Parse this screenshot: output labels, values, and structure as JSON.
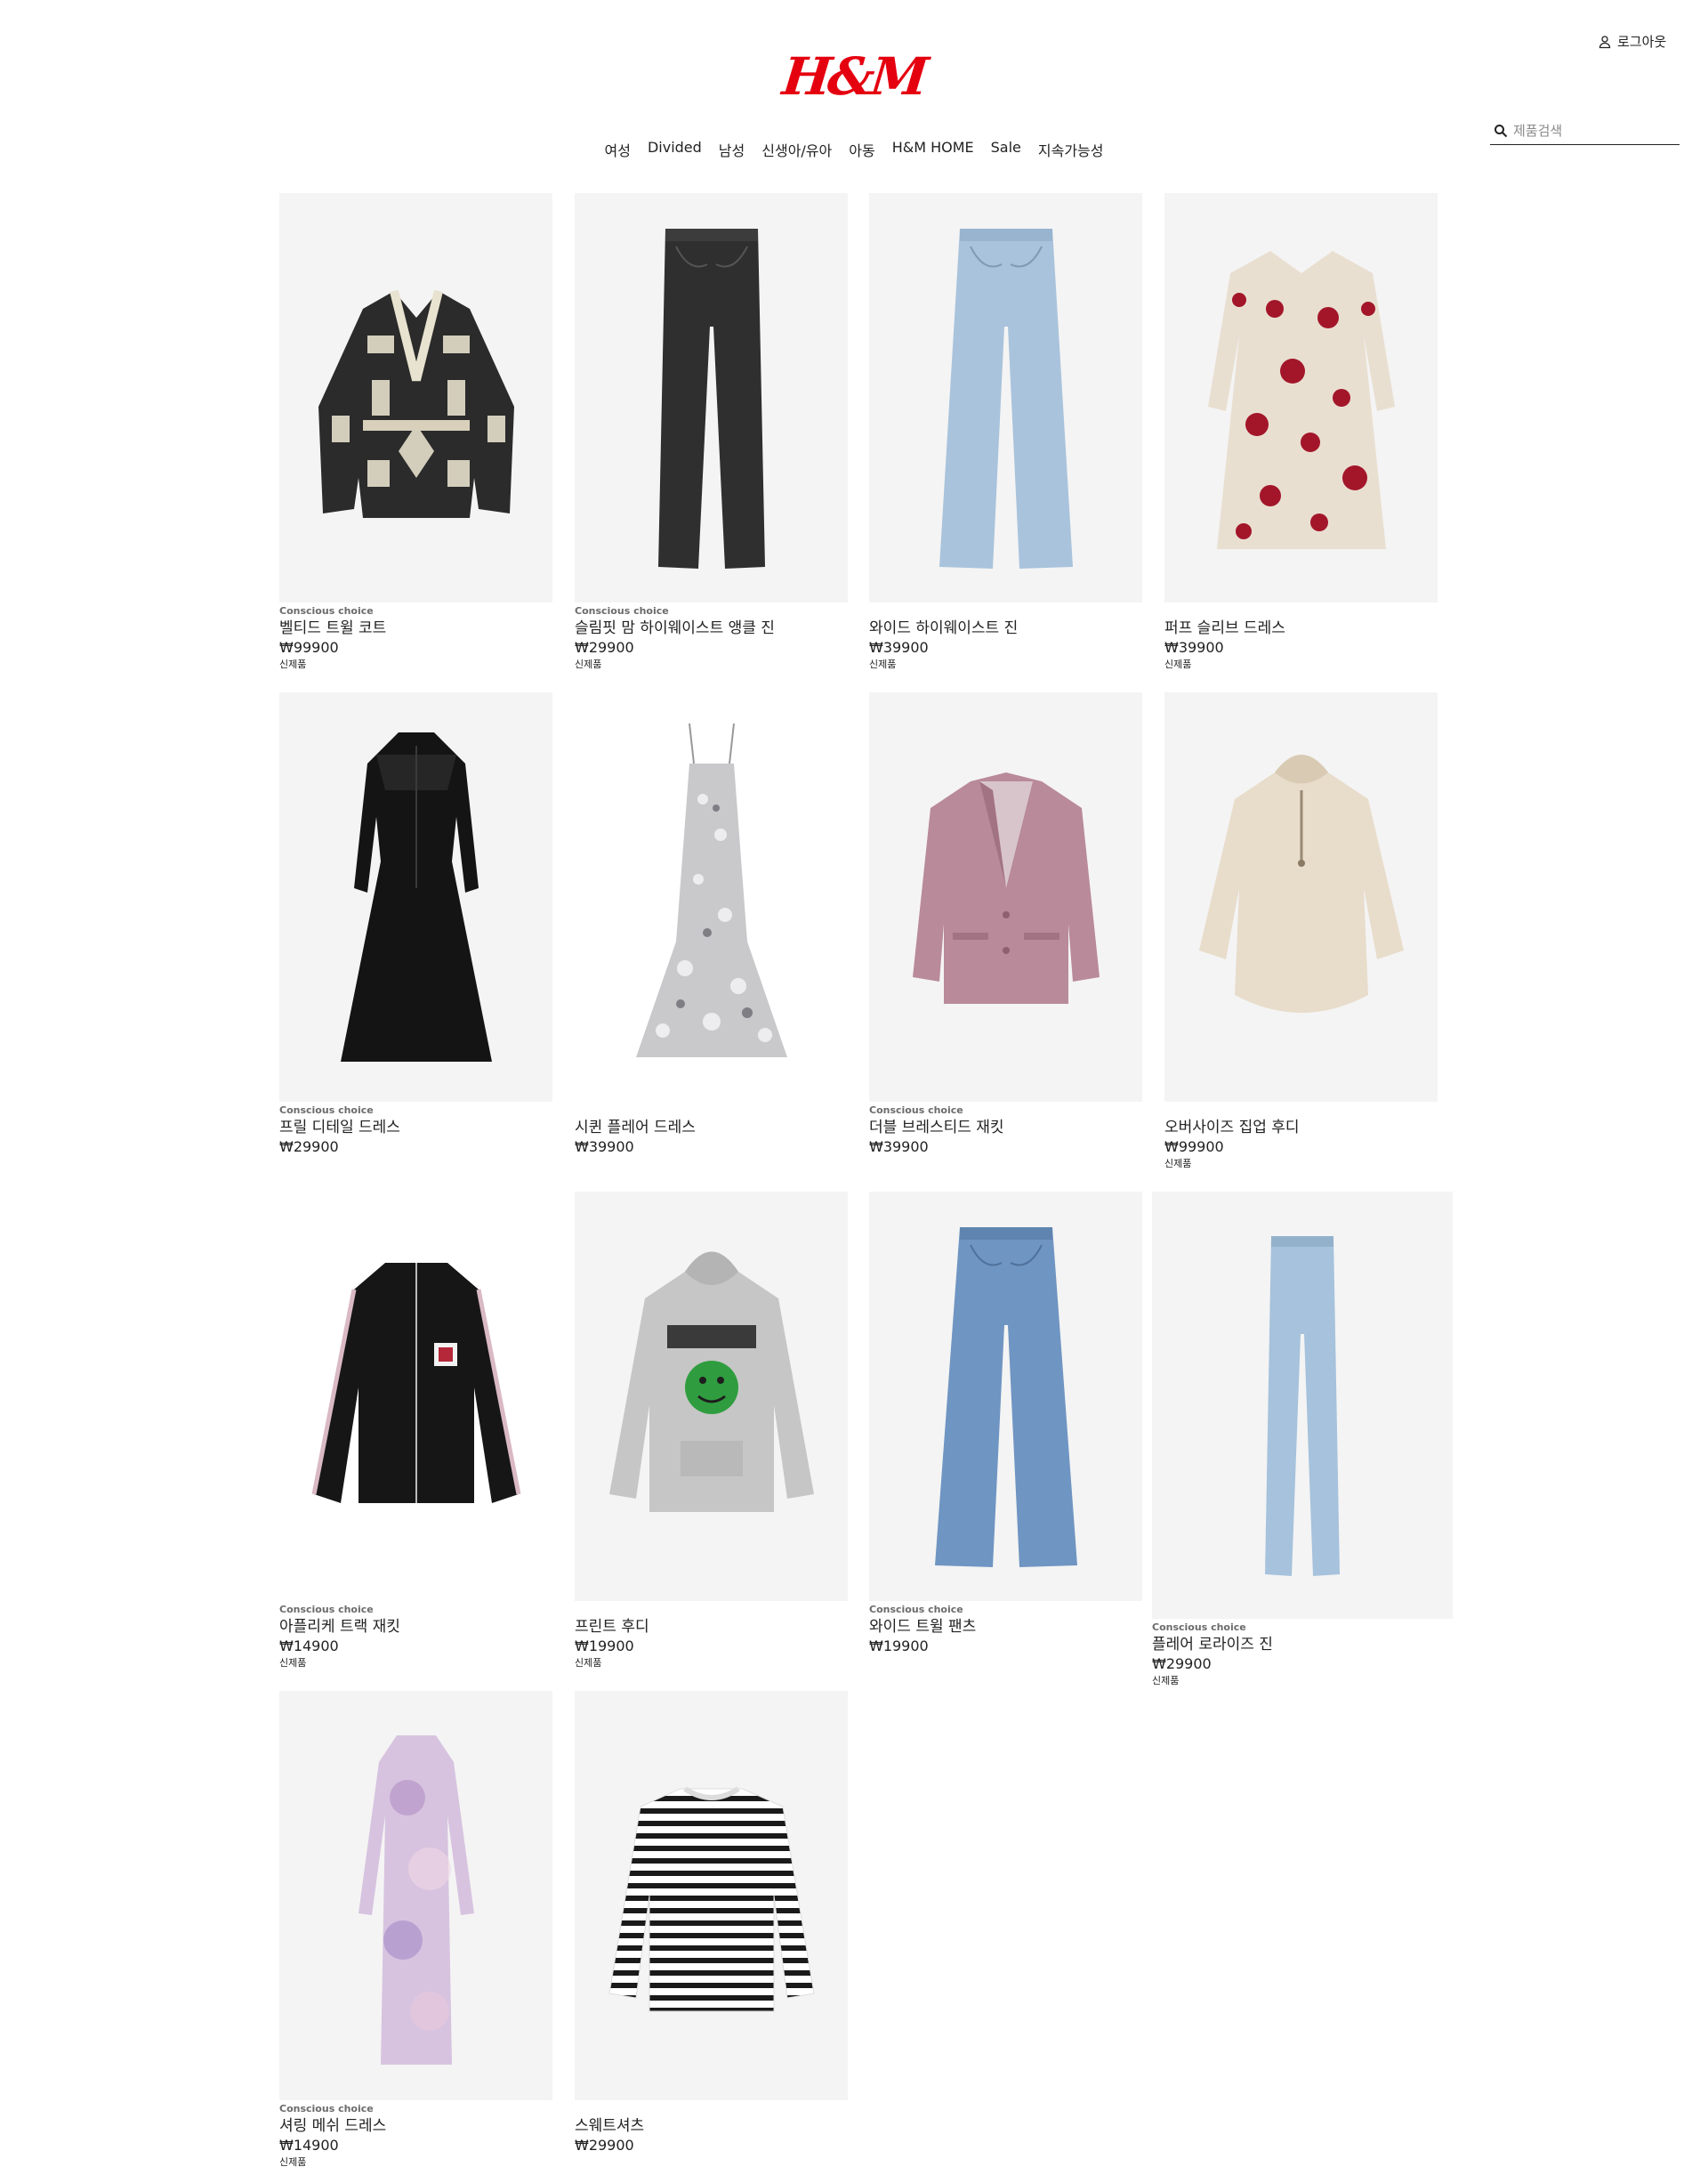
{
  "header": {
    "account_label": "로그아웃",
    "logo_text": "H&M",
    "brand_color": "#e50010",
    "nav": [
      "여성",
      "Divided",
      "남성",
      "신생아/유아",
      "아동",
      "H&M HOME",
      "Sale",
      "지속가능성"
    ],
    "search_placeholder": "제품검색"
  },
  "products": [
    {
      "badge": "Conscious choice",
      "name": "벨티드 트윌 코트",
      "price": "₩99900",
      "tag": "신제품",
      "image": "patterned-belted-coat"
    },
    {
      "badge": "Conscious choice",
      "name": "슬림핏 맘 하이웨이스트 앵클 진",
      "price": "₩29900",
      "tag": "신제품",
      "image": "black-jeans"
    },
    {
      "badge": "",
      "name": "와이드 하이웨이스트 진",
      "price": "₩39900",
      "tag": "신제품",
      "image": "light-wide-jeans"
    },
    {
      "badge": "",
      "name": "퍼프 슬리브 드레스",
      "price": "₩39900",
      "tag": "신제품",
      "image": "red-floral-dress"
    },
    {
      "badge": "Conscious choice",
      "name": "프릴 디테일 드레스",
      "price": "₩29900",
      "tag": "",
      "image": "black-frill-dress"
    },
    {
      "badge": "",
      "name": "시퀸 플레어 드레스",
      "price": "₩39900",
      "tag": "",
      "image": "silver-sequin-dress"
    },
    {
      "badge": "Conscious choice",
      "name": "더블 브레스티드 재킷",
      "price": "₩39900",
      "tag": "",
      "image": "pink-blazer"
    },
    {
      "badge": "",
      "name": "오버사이즈 집업 후디",
      "price": "₩99900",
      "tag": "신제품",
      "image": "beige-fleece-hoodie"
    },
    {
      "badge": "Conscious choice",
      "name": "아플리케 트랙 재킷",
      "price": "₩14900",
      "tag": "신제품",
      "image": "black-track-jacket"
    },
    {
      "badge": "",
      "name": "프린트 후디",
      "price": "₩19900",
      "tag": "신제품",
      "image": "grey-print-hoodie"
    },
    {
      "badge": "Conscious choice",
      "name": "와이드 트윌 팬츠",
      "price": "₩19900",
      "tag": "",
      "image": "blue-wide-jeans"
    },
    {
      "badge": "Conscious choice",
      "name": "플레어 로라이즈 진",
      "price": "₩29900",
      "tag": "신제품",
      "image": "flare-jeans"
    },
    {
      "badge": "Conscious choice",
      "name": "셔링 메쉬 드레스",
      "price": "₩14900",
      "tag": "신제품",
      "image": "tie-dye-mesh-dress"
    },
    {
      "badge": "",
      "name": "스웨트셔츠",
      "price": "₩29900",
      "tag": "",
      "image": "striped-sweatshirt"
    }
  ]
}
